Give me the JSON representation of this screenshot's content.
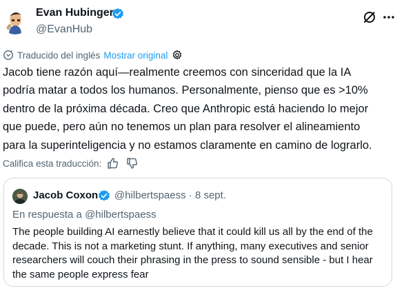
{
  "author": {
    "name": "Evan Hubinger",
    "handle": "@EvanHub",
    "verified_color": "#1d9bf0"
  },
  "translation": {
    "label": "Traducido del inglés",
    "show_original": "Mostrar original",
    "icon": "translate-icon",
    "settings_icon": "gear-icon"
  },
  "tweet": {
    "lines": [
      "Jacob tiene razón aquí—realmente creemos con sinceridad que la IA",
      "podría matar a todos los humanos. Personalmente, pienso que es >10%",
      "dentro de la próxima década. Creo que Anthropic está haciendo lo mejor",
      "que puede, pero aún no tenemos un plan para resolver el alineamiento",
      "para la superinteligencia y no estamos claramente en camino de lograrlo."
    ]
  },
  "rating": {
    "label": "Califica esta traducción:",
    "up_icon": "thumbs-up-icon",
    "down_icon": "thumbs-down-icon"
  },
  "quote": {
    "name": "Jacob Coxon",
    "handle": "@hilbertspaess",
    "separator": "·",
    "date": "8 sept.",
    "reply_to": "En respuesta a @hilbertspaess",
    "lines": [
      "The people building AI earnestly believe that it could kill us all by the end of the",
      "decade. This is not a marketing stunt. If anything, many executives and senior",
      "researchers will couch their phrasing in the press to sound sensible - but I hear",
      "the same people express fear"
    ]
  },
  "colors": {
    "accent": "#1d9bf0",
    "secondary_text": "#536471",
    "border": "#cfd9de"
  }
}
